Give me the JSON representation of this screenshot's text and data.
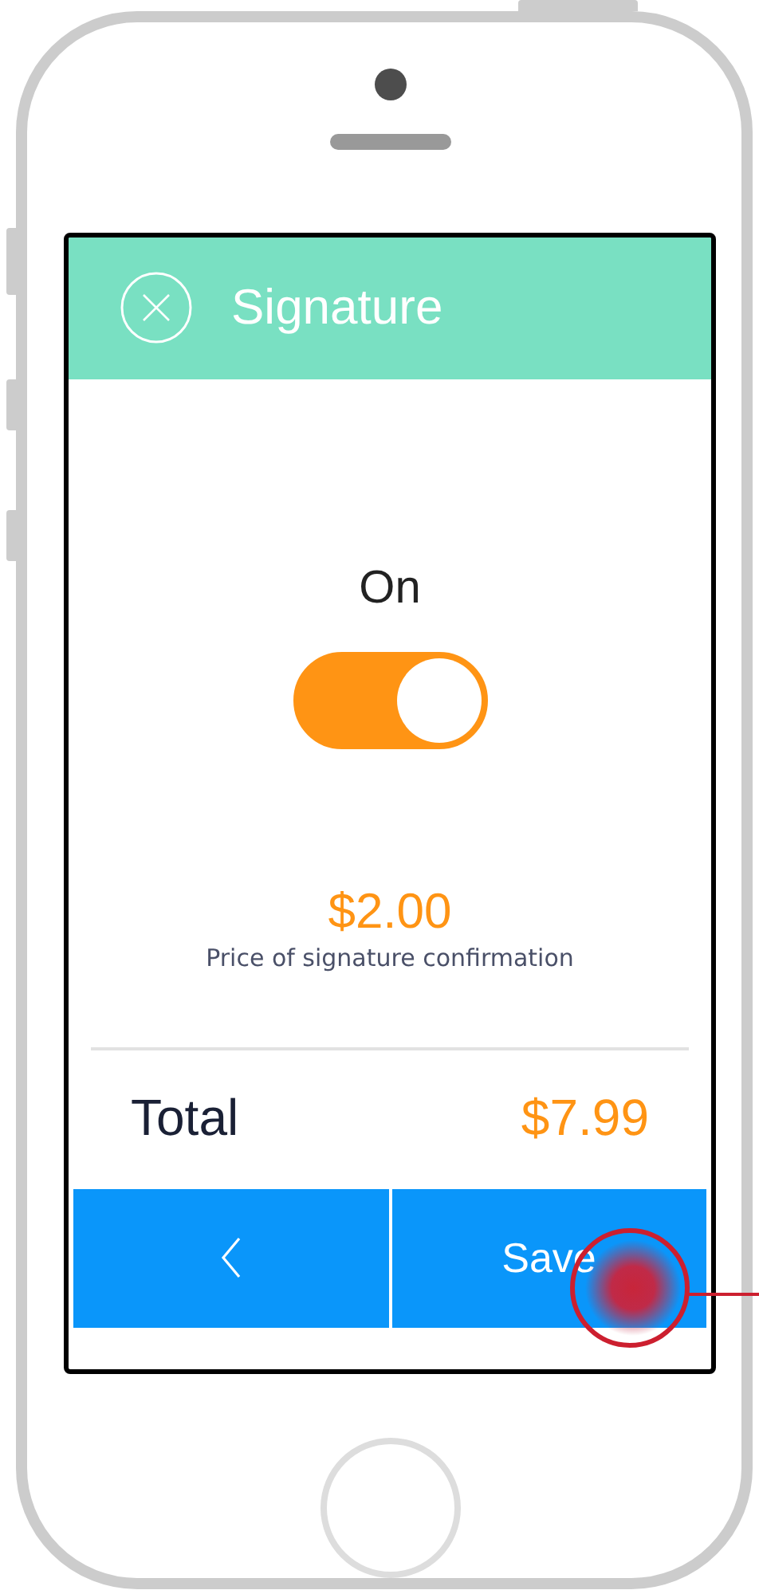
{
  "header": {
    "title": "Signature"
  },
  "toggle": {
    "label": "On",
    "on": true
  },
  "price": {
    "amount": "$2.00",
    "caption": "Price of signature confirmation"
  },
  "total": {
    "label": "Total",
    "value": "$7.99"
  },
  "buttons": [
    {
      "kind": "back"
    },
    {
      "kind": "save",
      "label": "Save"
    }
  ]
}
